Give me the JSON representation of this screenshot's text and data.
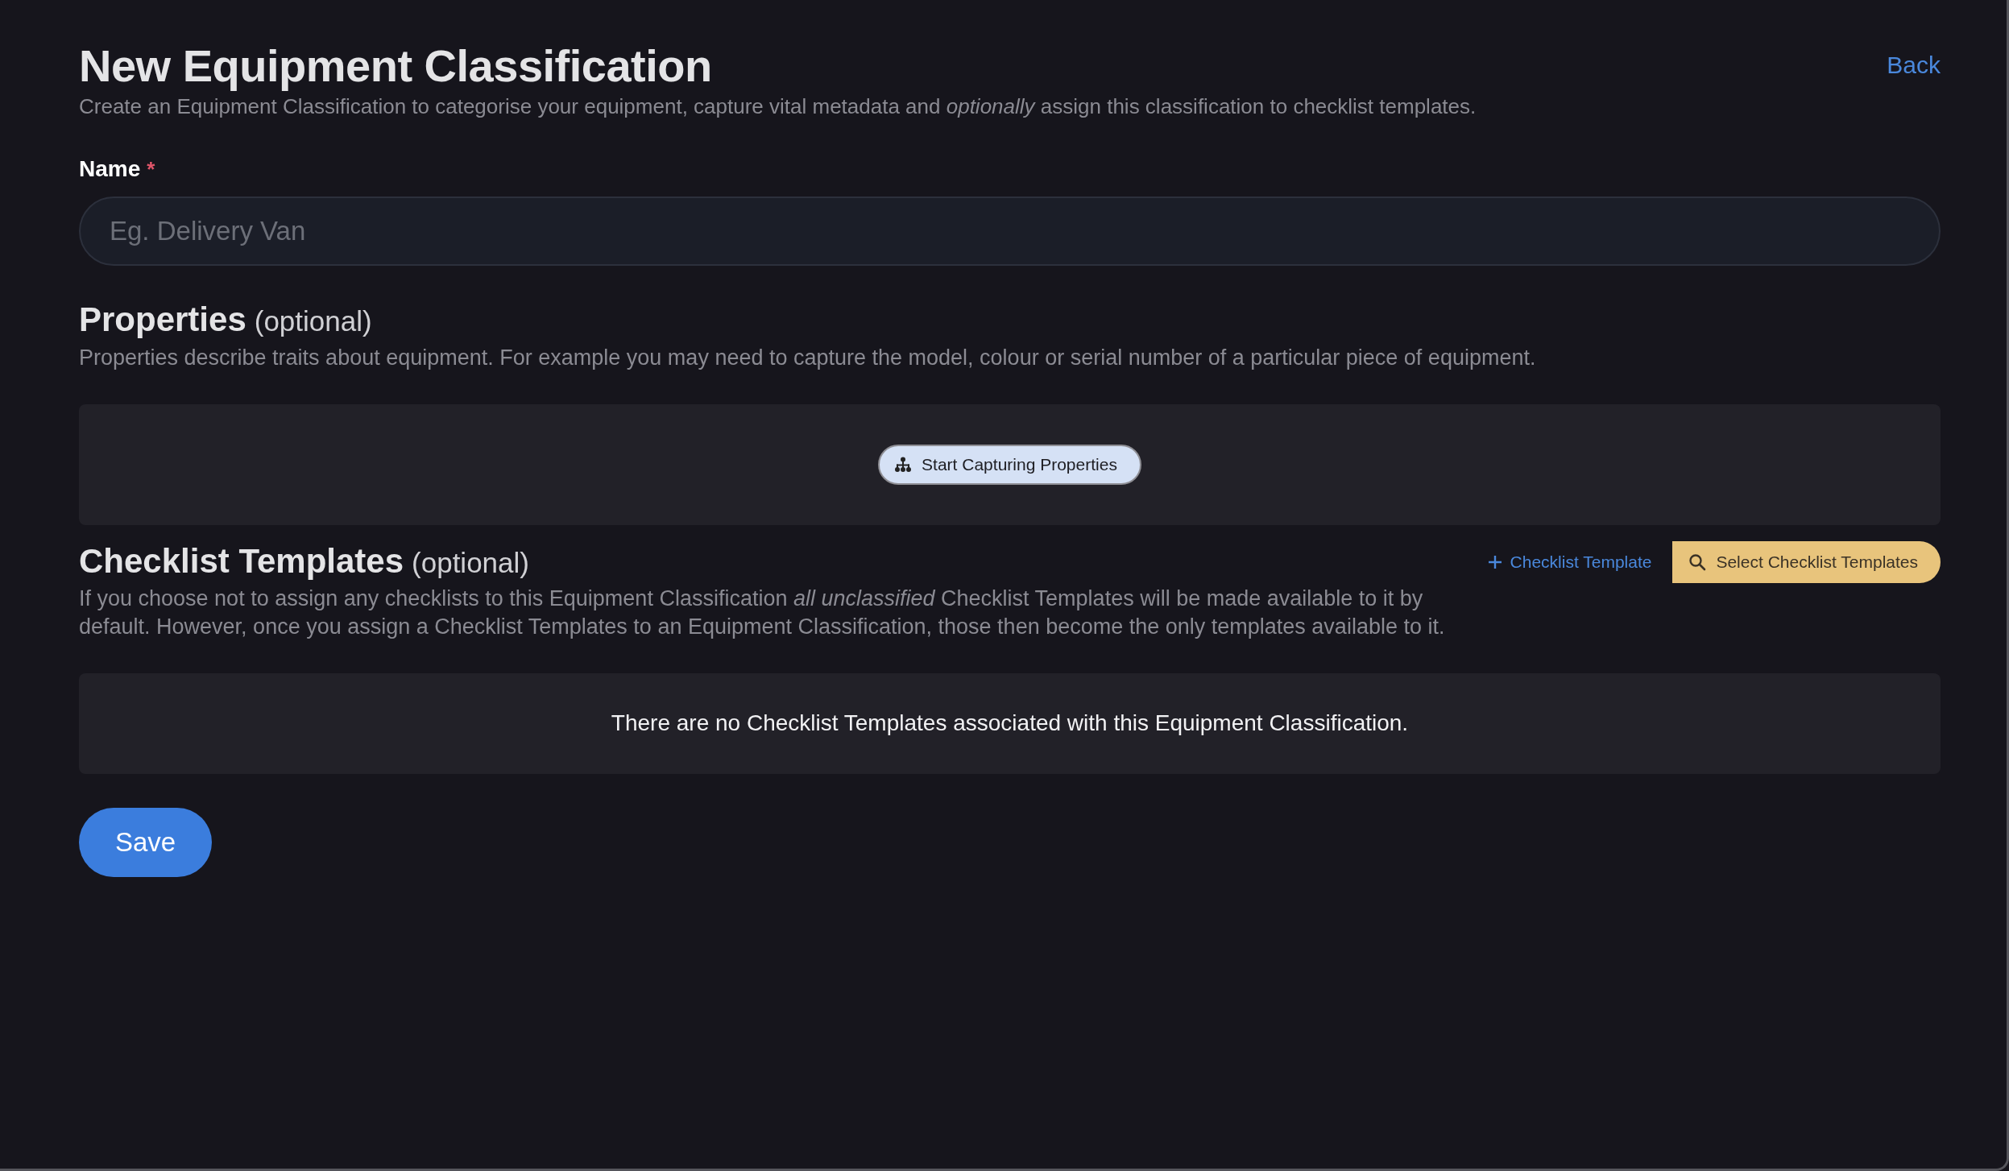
{
  "header": {
    "title": "New Equipment Classification",
    "subtitle": "Create an Equipment Classification to categorise your equipment, capture vital metadata and *optionally* assign this classification to checklist templates.",
    "back_link": "Back"
  },
  "name_field": {
    "label": "Name",
    "required": true,
    "required_mark": "*",
    "placeholder": "Eg. Delivery Van"
  },
  "properties": {
    "title": "Properties",
    "optional_note": "(optional)",
    "description": "Properties describe traits about equipment. For example you may need to capture the model, colour or serial number of a particular piece of equipment.",
    "start_button": "Start Capturing Properties"
  },
  "checklist_templates": {
    "title": "Checklist Templates",
    "optional_note": "(optional)",
    "description": "If you choose not to assign any checklists to this Equipment Classification *all unclassified* Checklist Templates will be made available to it by default. However, once you assign a Checklist Templates to an Equipment Classification, those then become the only templates available to it.",
    "add_button": "Checklist Template",
    "select_button": "Select Checklist Templates",
    "empty_message": "There are no Checklist Templates associated with this Equipment Classification."
  },
  "save_button": "Save"
}
